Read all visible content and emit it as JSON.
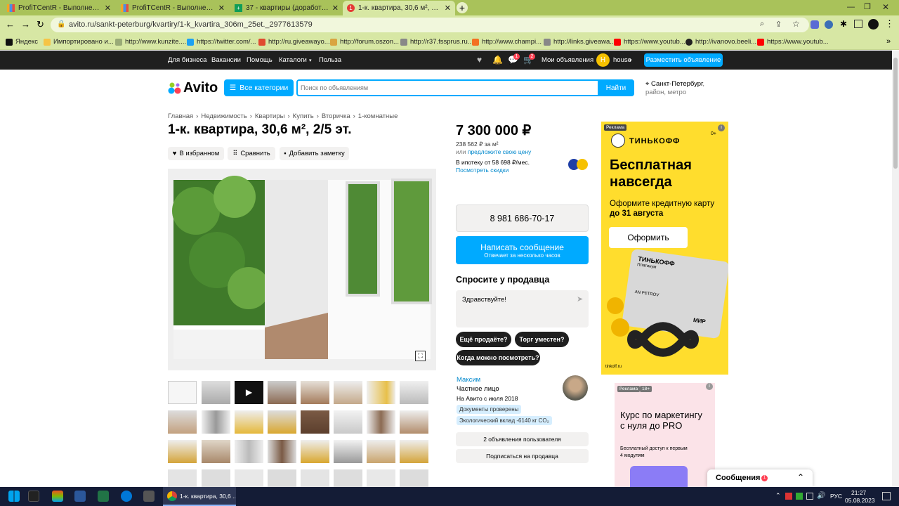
{
  "browser": {
    "tabs": [
      {
        "title": "ProfiTCentR - Выполнение задач",
        "color": "#f5a623"
      },
      {
        "title": "ProfiTCentR - Выполнение задач",
        "color": "#f5a623"
      },
      {
        "title": "37 - квартиры (доработанная) - Google Таблицы",
        "color": "#0f9d58"
      },
      {
        "title": "1-к. квартира, 30,6 м², 2/5 эт. на продажу",
        "color": "#e53935",
        "badge": "1"
      }
    ],
    "url": "avito.ru/sankt-peterburg/kvartiry/1-k_kvartira_306m_25et._2977613579",
    "bookmarks": [
      "Яндекс",
      "Импортировано и...",
      "http://www.kunzite....",
      "https://twitter.com/...",
      "http://ru.giveawayo...",
      "http://forum.oszon...",
      "http://r37.fssprus.ru...",
      "http://www.champi...",
      "http://links.giveawa...",
      "https://www.youtub...",
      "http://ivanovo.beeli...",
      "https://www.youtub..."
    ]
  },
  "topnav": {
    "items": [
      "Для бизнеса",
      "Вакансии",
      "Помощь",
      "Каталоги",
      "Польза"
    ],
    "my_ads": "Мои объявления",
    "user": "house",
    "user_initial": "H",
    "post_btn": "Разместить объявление",
    "badge1": "1",
    "badge2": "2"
  },
  "header": {
    "logo": "Avito",
    "categories": "Все категории",
    "search_placeholder": "Поиск по объявлениям",
    "search_btn": "Найти",
    "location_city": "Санкт-Петербург",
    "location_rest": ", район, метро"
  },
  "breadcrumbs": [
    "Главная",
    "Недвижимость",
    "Квартиры",
    "Купить",
    "Вторичка",
    "1-комнатные"
  ],
  "listing": {
    "title": "1-к. квартира, 30,6 м², 2/5 эт.",
    "fav": "В избранном",
    "compare": "Сравнить",
    "note": "Добавить заметку",
    "price": "7 300 000 ₽",
    "per_m": "238 562 ₽ за м²",
    "or": "или",
    "propose": "предложите свою цену",
    "mortgage": "В ипотеку от 58 698 ₽/мес.",
    "discounts": "Посмотреть скидки",
    "phone": "8 981 686-70-17",
    "write": "Написать сообщение",
    "write_sub": "Отвечает за несколько часов",
    "ask_title": "Спросите у продавца",
    "ask_text": "Здравствуйте!",
    "chips": [
      "Ещё продаёте?",
      "Торг уместен?",
      "Когда можно посмотреть?"
    ],
    "seller_name": "Максим",
    "seller_type": "Частное лицо",
    "seller_since": "На Авито с июля 2018",
    "tags": [
      "Документы проверены",
      "Экологический вклад -6140 кг CO₂"
    ],
    "seller_ads": "2 объявления пользователя",
    "subscribe": "Подписаться на продавца"
  },
  "ad1": {
    "label": "Реклама",
    "age": "0+",
    "brand": "ТИНЬКОФФ",
    "headline": "Бесплатная навсегда",
    "text": "Оформите кредитную карту",
    "text_bold": "до 31 августа",
    "btn": "Оформить",
    "card_brand": "ТИНЬКОФФ",
    "card_sub": "Платинум",
    "card_name": "AN PETROV",
    "mir": "МИР",
    "site": "tinkoff.ru"
  },
  "ad2": {
    "label": "Реклама",
    "age": "18+",
    "headline": "Курс по маркетингу с нуля до PRO",
    "sub": "Бесплатный доступ к первым 4 модулям"
  },
  "messages": {
    "label": "Сообщения",
    "count": "1"
  },
  "taskbar": {
    "app": "1-к. квартира, 30,6 ...",
    "lang": "РУС",
    "time": "21:27",
    "date": "05.08.2023"
  }
}
